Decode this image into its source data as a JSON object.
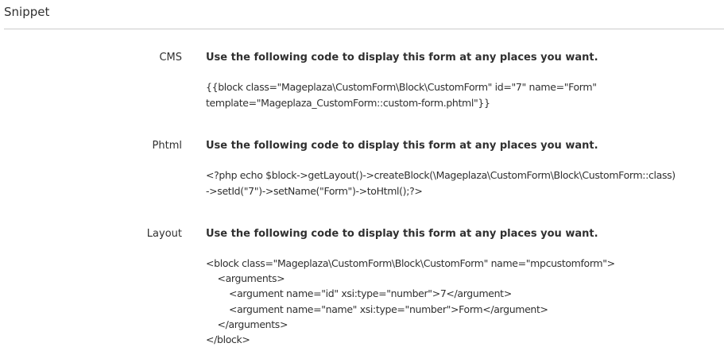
{
  "section": {
    "title": "Snippet"
  },
  "rows": [
    {
      "label": "CMS",
      "heading": "Use the following code to display this form at any places you want.",
      "code": "{{block class=\"Mageplaza\\CustomForm\\Block\\CustomForm\" id=\"7\" name=\"Form\"\ntemplate=\"Mageplaza_CustomForm::custom-form.phtml\"}}"
    },
    {
      "label": "Phtml",
      "heading": "Use the following code to display this form at any places you want.",
      "code": "<?php echo $block->getLayout()->createBlock(\\Mageplaza\\CustomForm\\Block\\CustomForm::class)\n->setId(\"7\")->setName(\"Form\")->toHtml();?>"
    },
    {
      "label": "Layout",
      "heading": "Use the following code to display this form at any places you want.",
      "code": "<block class=\"Mageplaza\\CustomForm\\Block\\CustomForm\" name=\"mpcustomform\">\n    <arguments>\n        <argument name=\"id\" xsi:type=\"number\">7</argument>\n        <argument name=\"name\" xsi:type=\"number\">Form</argument>\n    </arguments>\n</block>"
    }
  ]
}
